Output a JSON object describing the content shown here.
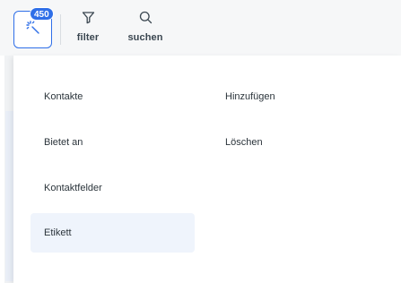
{
  "toolbar": {
    "magic_badge": "450",
    "filter_label": "filter",
    "search_label": "suchen",
    "accent_color": "#2f6fe8",
    "icons": {
      "magic": "magic-wand-icon",
      "filter": "filter-icon",
      "search": "search-icon"
    }
  },
  "menu": {
    "left": [
      {
        "label": "Kontakte"
      },
      {
        "label": "Bietet an"
      },
      {
        "label": "Kontaktfelder"
      },
      {
        "label": "Etikett",
        "active": true
      }
    ],
    "right": [
      {
        "label": "Hinzufügen"
      },
      {
        "label": "Löschen"
      }
    ]
  }
}
